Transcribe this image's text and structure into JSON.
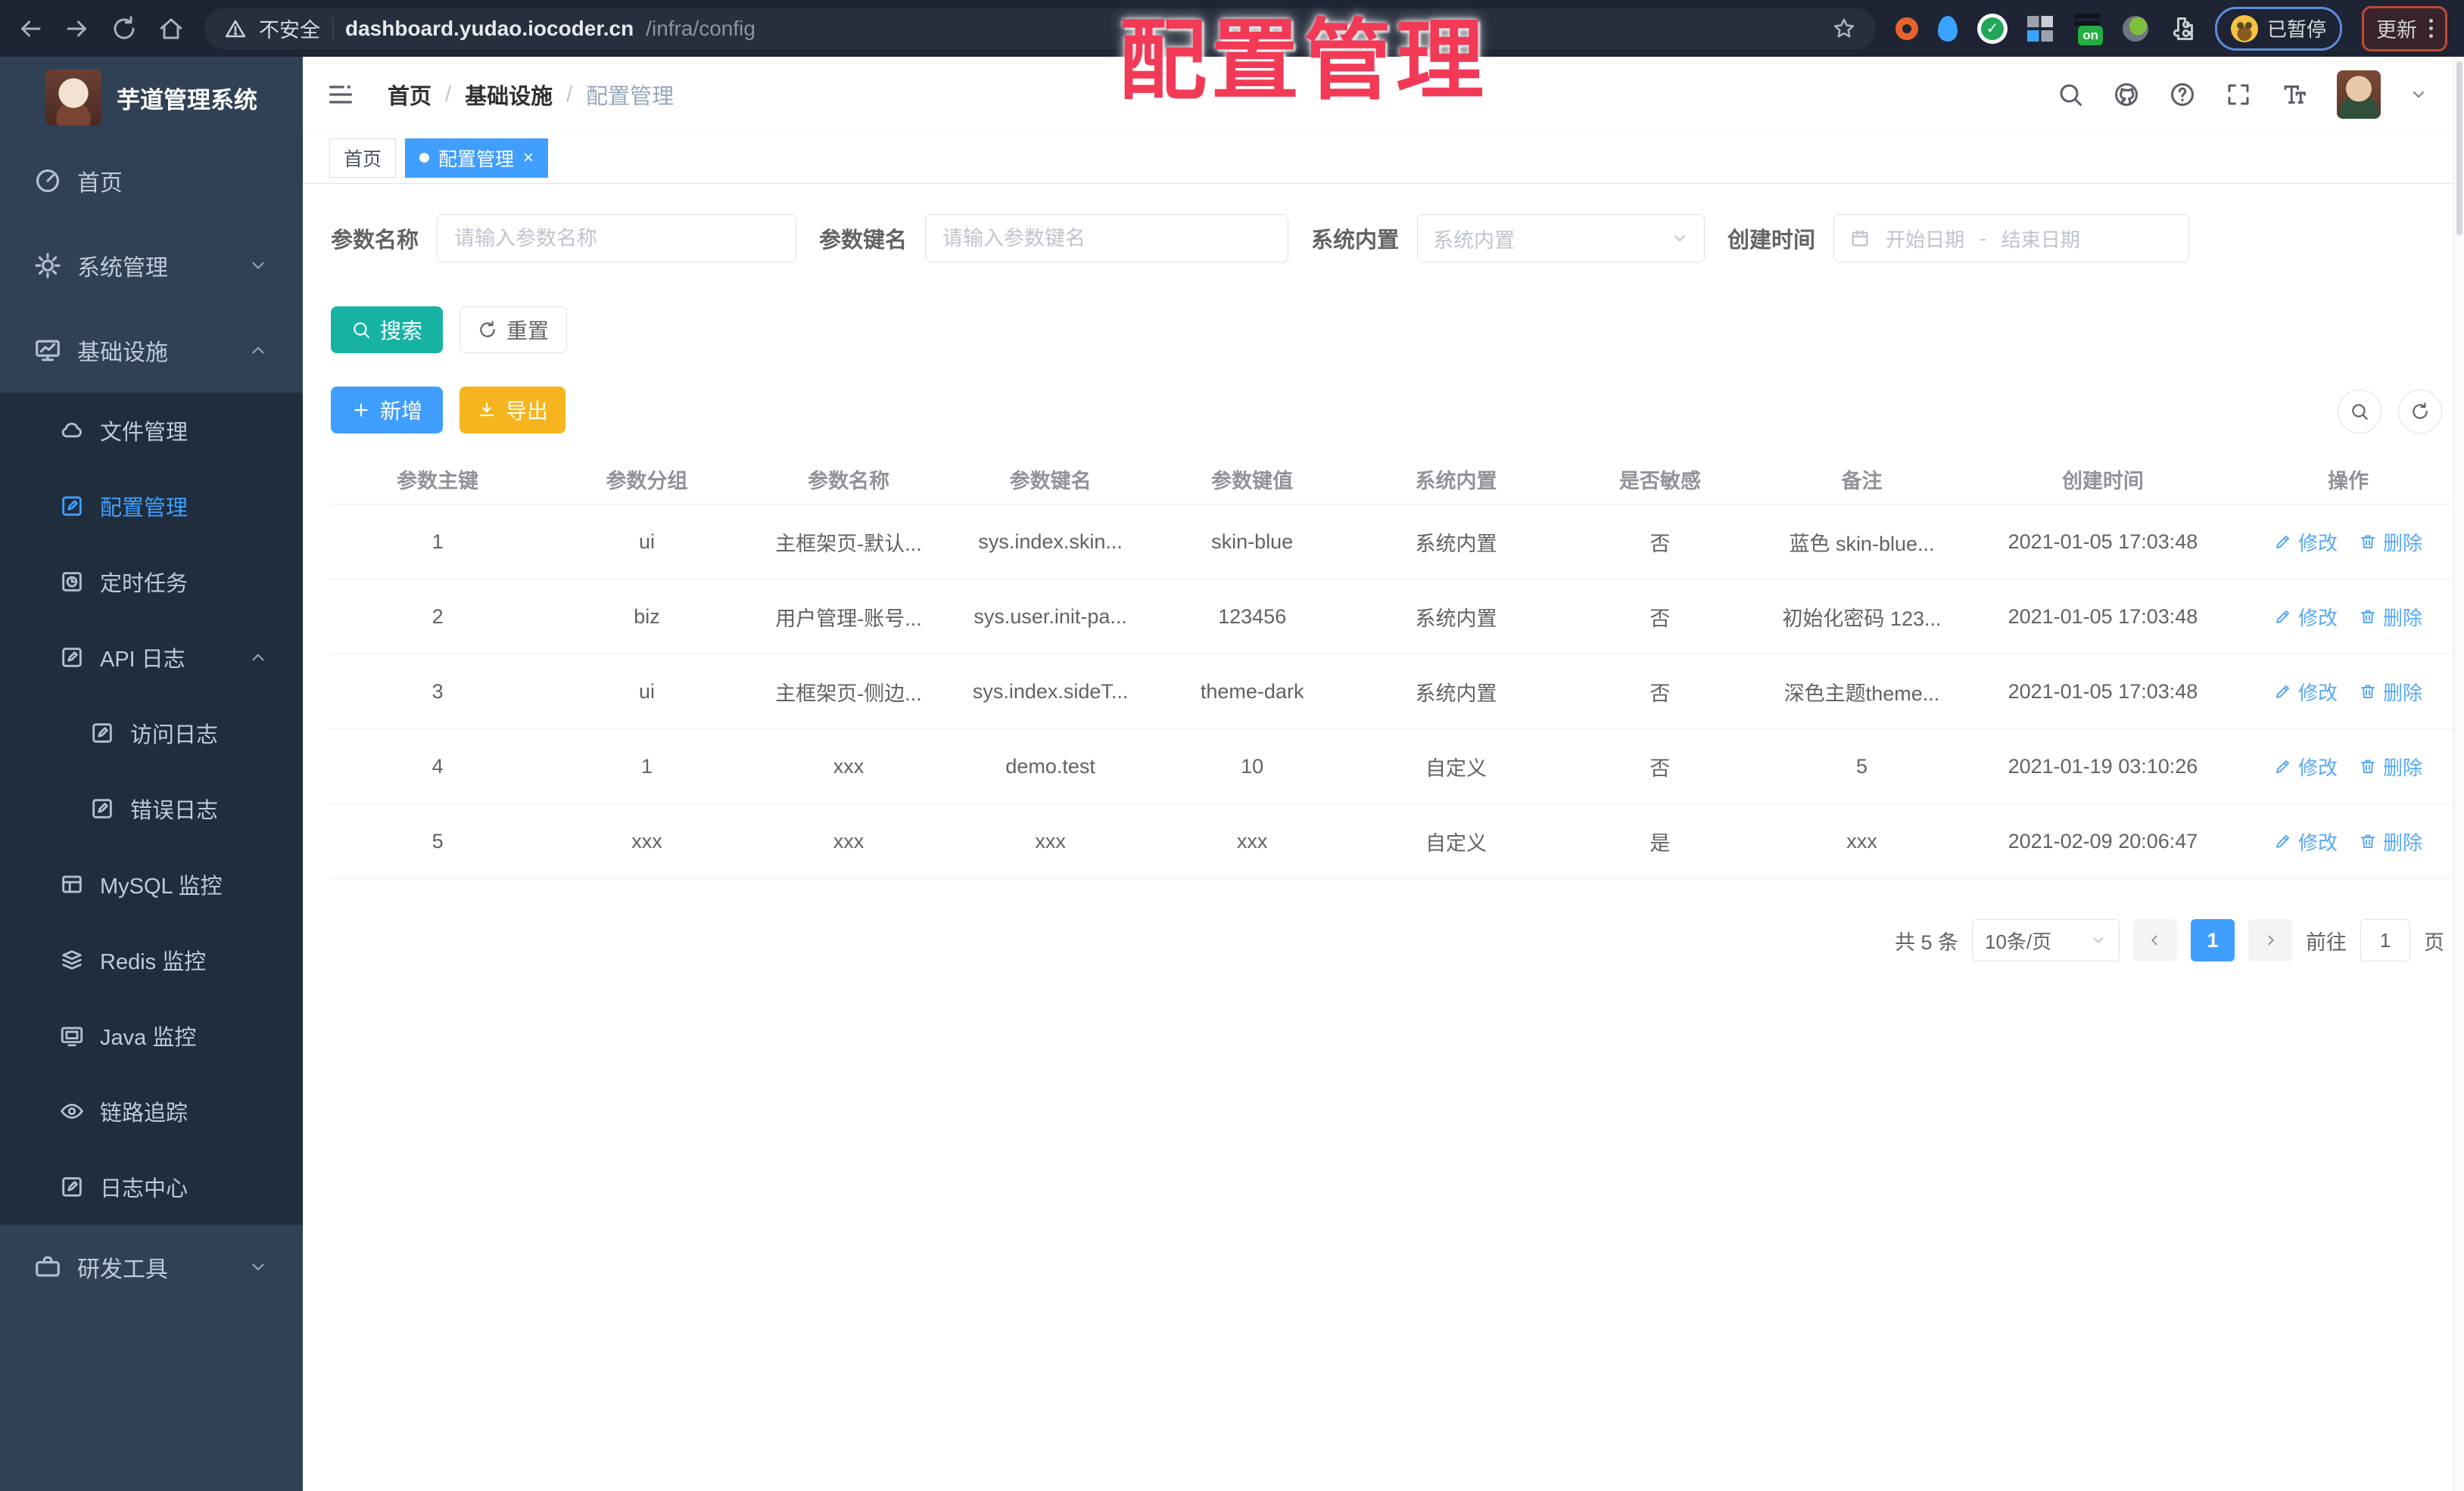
{
  "colors": {
    "accent": "#409eff",
    "teal": "#16b3a3",
    "warn": "#f6b51e",
    "sidebarBg": "#304156",
    "submenuBg": "#1f2d3d",
    "sideText": "#bfcbd9",
    "browserBg": "#1e2433",
    "overlayRed": "#f23a57"
  },
  "browser": {
    "security_label": "不安全",
    "url_host": "dashboard.yudao.iocoder.cn",
    "url_path": "/infra/config",
    "ext_on_label": "on",
    "paused_label": "已暂停",
    "update_label": "更新"
  },
  "overlay_title": "配置管理",
  "sidebar": {
    "app_title": "芋道管理系统",
    "items": [
      {
        "label": "首页"
      },
      {
        "label": "系统管理"
      },
      {
        "label": "基础设施"
      },
      {
        "label": "文件管理"
      },
      {
        "label": "配置管理"
      },
      {
        "label": "定时任务"
      },
      {
        "label": "API 日志"
      },
      {
        "label": "访问日志"
      },
      {
        "label": "错误日志"
      },
      {
        "label": "MySQL 监控"
      },
      {
        "label": "Redis 监控"
      },
      {
        "label": "Java 监控"
      },
      {
        "label": "链路追踪"
      },
      {
        "label": "日志中心"
      },
      {
        "label": "研发工具"
      }
    ]
  },
  "header": {
    "breadcrumb": [
      "首页",
      "基础设施",
      "配置管理"
    ],
    "sep": "/"
  },
  "tags": {
    "home": "首页",
    "current": "配置管理"
  },
  "filters": {
    "name_label": "参数名称",
    "name_placeholder": "请输入参数名称",
    "key_label": "参数键名",
    "key_placeholder": "请输入参数键名",
    "type_label": "系统内置",
    "type_placeholder": "系统内置",
    "date_label": "创建时间",
    "date_start": "开始日期",
    "date_sep": "-",
    "date_end": "结束日期"
  },
  "toolbar": {
    "search_label": "搜索",
    "reset_label": "重置",
    "add_label": "新增",
    "export_label": "导出"
  },
  "table": {
    "headers": [
      "参数主键",
      "参数分组",
      "参数名称",
      "参数键名",
      "参数键值",
      "系统内置",
      "是否敏感",
      "备注",
      "创建时间",
      "操作"
    ],
    "rows": [
      [
        "1",
        "ui",
        "主框架页-默认...",
        "sys.index.skin...",
        "skin-blue",
        "系统内置",
        "否",
        "蓝色 skin-blue...",
        "2021-01-05 17:03:48"
      ],
      [
        "2",
        "biz",
        "用户管理-账号...",
        "sys.user.init-pa...",
        "123456",
        "系统内置",
        "否",
        "初始化密码 123...",
        "2021-01-05 17:03:48"
      ],
      [
        "3",
        "ui",
        "主框架页-侧边...",
        "sys.index.sideT...",
        "theme-dark",
        "系统内置",
        "否",
        "深色主题theme...",
        "2021-01-05 17:03:48"
      ],
      [
        "4",
        "1",
        "xxx",
        "demo.test",
        "10",
        "自定义",
        "否",
        "5",
        "2021-01-19 03:10:26"
      ],
      [
        "5",
        "xxx",
        "xxx",
        "xxx",
        "xxx",
        "自定义",
        "是",
        "xxx",
        "2021-02-09 20:06:47"
      ]
    ],
    "edit_label": "修改",
    "delete_label": "删除"
  },
  "pagination": {
    "total": "共 5 条",
    "page_size": "10条/页",
    "current_page": "1",
    "goto_label": "前往",
    "page_unit": "页"
  }
}
